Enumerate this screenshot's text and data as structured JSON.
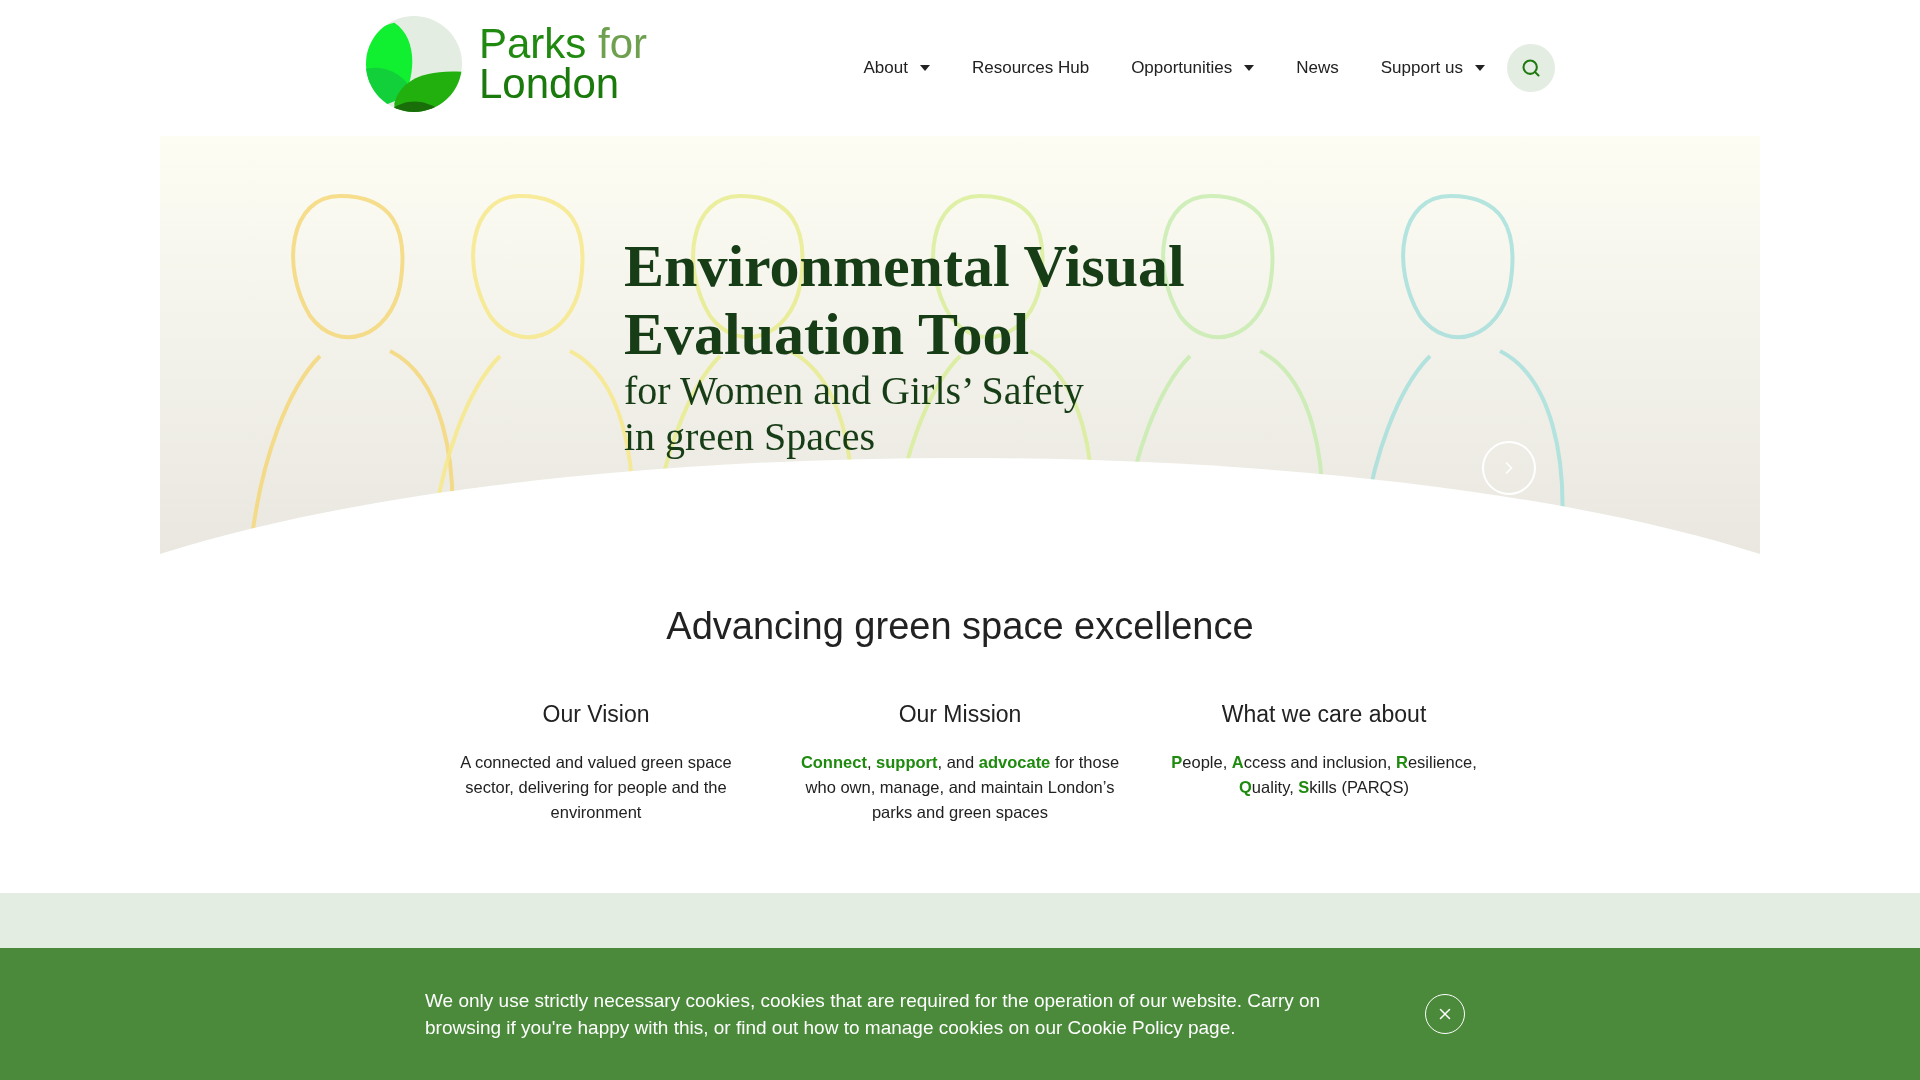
{
  "logo": {
    "name": "Parks",
    "name_suffix": "for",
    "name_line_2": "London"
  },
  "nav": [
    {
      "label": "About",
      "dropdown": true
    },
    {
      "label": "Resources Hub",
      "dropdown": false
    },
    {
      "label": "Opportunities",
      "dropdown": true
    },
    {
      "label": "News",
      "dropdown": false
    },
    {
      "label": "Support us",
      "dropdown": true
    }
  ],
  "hero": {
    "title": "Environmental Visual Evaluation Tool",
    "subtitle": "for Women and Girls’ Safety in green Spaces"
  },
  "intro": {
    "heading": "Advancing green space excellence"
  },
  "pillars": [
    {
      "title": "Our Vision",
      "text": "A connected and valued green space sector, delivering for people and the environment"
    },
    {
      "title": "Our Mission",
      "text": "**Connect**, **support**, and **advocate** for those who own, manage, and maintain London’s parks and green spaces"
    },
    {
      "title": "What we care about",
      "text": "**P**eople, **A**ccess and inclusion, **R**esilience, **Q**uality, **S**kills (PARQS)"
    }
  ],
  "cookie_banner": {
    "text": "We only use strictly necessary cookies, cookies that are required for the operation of our website. Carry on browsing if you're happy with this, or find out how to manage cookies on our Cookie Policy page."
  }
}
